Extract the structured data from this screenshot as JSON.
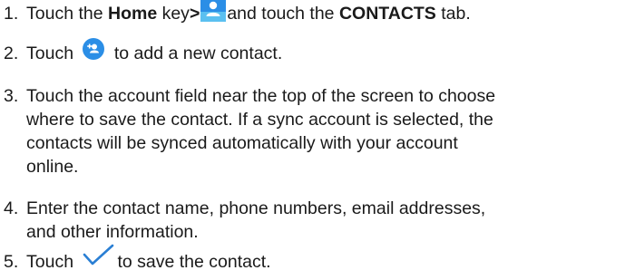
{
  "steps": [
    {
      "number": "1.",
      "pre": "Touch the ",
      "bold1": "Home",
      "mid": " key",
      "gt": ">",
      "icon": "contacts-app-icon",
      "post1": "and touch the ",
      "bold2": "CONTACTS",
      "post2": " tab."
    },
    {
      "number": "2.",
      "pre": "Touch ",
      "icon": "add-contact-icon",
      "post": " to add a new contact."
    },
    {
      "number": "3.",
      "lines": [
        "Touch the account field near the top of the screen to choose",
        "where to save the contact. If a sync account is selected, the",
        "contacts will be synced automatically with your account",
        "online."
      ]
    },
    {
      "number": "4.",
      "lines": [
        "Enter the contact name, phone numbers, email addresses,",
        "and other information."
      ]
    },
    {
      "number": "5.",
      "pre": "Touch ",
      "icon": "checkmark-icon",
      "post": "to save the contact."
    }
  ],
  "colors": {
    "text": "#1a1a1a",
    "icon_blue": "#2b8ee6",
    "icon_light_blue": "#5bc0f0",
    "check_blue": "#2a7fd4"
  }
}
